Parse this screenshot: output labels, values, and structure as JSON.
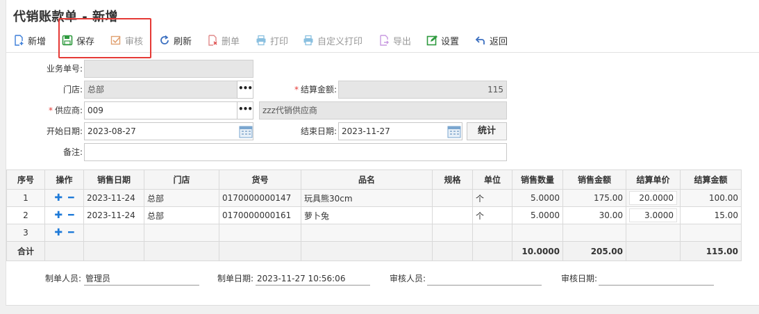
{
  "title": "代销账款单 - 新增",
  "toolbar": {
    "add": "新增",
    "save": "保存",
    "audit": "审核",
    "refresh": "刷新",
    "delete": "删单",
    "print": "打印",
    "custom_print": "自定义打印",
    "export": "导出",
    "settings": "设置",
    "back": "返回"
  },
  "form": {
    "biz_no_label": "业务单号:",
    "biz_no_value": "",
    "store_label": "门店:",
    "store_value": "总部",
    "settle_amount_label": "结算金额:",
    "settle_amount_value": "115",
    "supplier_label": "供应商:",
    "supplier_code": "009",
    "supplier_name": "zzz代销供应商",
    "start_date_label": "开始日期:",
    "start_date_value": "2023-08-27",
    "end_date_label": "结束日期:",
    "end_date_value": "2023-11-27",
    "stats_button": "统计",
    "remark_label": "备注:",
    "remark_value": "",
    "required_mark": "*"
  },
  "grid": {
    "headers": [
      "序号",
      "操作",
      "销售日期",
      "门店",
      "货号",
      "品名",
      "规格",
      "单位",
      "销售数量",
      "销售金额",
      "结算单价",
      "结算金额"
    ],
    "plus": "✚",
    "minus": "━",
    "rows": [
      {
        "no": "1",
        "date": "2023-11-24",
        "store": "总部",
        "sku": "0170000000147",
        "name": "玩具熊30cm",
        "spec": "",
        "unit": "个",
        "qty": "5.0000",
        "sales_amount": "175.00",
        "settle_price": "20.0000",
        "settle_amount": "100.00"
      },
      {
        "no": "2",
        "date": "2023-11-24",
        "store": "总部",
        "sku": "0170000000161",
        "name": "萝卜兔",
        "spec": "",
        "unit": "个",
        "qty": "5.0000",
        "sales_amount": "30.00",
        "settle_price": "3.0000",
        "settle_amount": "15.00"
      },
      {
        "no": "3",
        "date": "",
        "store": "",
        "sku": "",
        "name": "",
        "spec": "",
        "unit": "",
        "qty": "",
        "sales_amount": "",
        "settle_price": "",
        "settle_amount": ""
      }
    ],
    "total": {
      "label": "合计",
      "qty": "10.0000",
      "sales_amount": "205.00",
      "settle_amount": "115.00"
    }
  },
  "footer": {
    "maker_label": "制单人员:",
    "maker_value": "管理员",
    "make_date_label": "制单日期:",
    "make_date_value": "2023-11-27 10:56:06",
    "auditor_label": "审核人员:",
    "auditor_value": "",
    "audit_date_label": "审核日期:",
    "audit_date_value": ""
  },
  "colors": {
    "highlight": "#e53935",
    "accent_blue": "#1e7ad8",
    "required": "#e53935"
  }
}
